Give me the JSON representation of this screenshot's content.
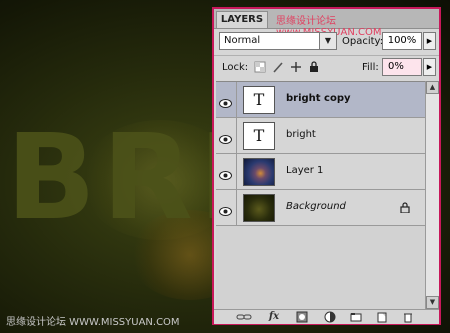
{
  "background": {
    "text": "BRI",
    "watermark_bottom": "思缘设计论坛 WWW.MISSYUAN.COM"
  },
  "panel": {
    "tab_label": "LAYERS",
    "watermark_top": "思缘设计论坛 www.MISSYUAN.COM",
    "blend_mode": "Normal",
    "opacity_label": "Opacity:",
    "opacity_value": "100%",
    "lock_label": "Lock:",
    "fill_label": "Fill:",
    "fill_value": "0%",
    "layers": [
      {
        "name": "bright copy",
        "thumb": "T",
        "selected": true
      },
      {
        "name": "bright",
        "thumb": "T",
        "selected": false
      },
      {
        "name": "Layer 1",
        "thumb": "",
        "selected": false
      },
      {
        "name": "Background",
        "thumb": "",
        "selected": false
      }
    ],
    "bottom_icons": [
      "link-layers-icon",
      "fx-icon",
      "add-mask-icon",
      "adjustment-layer-icon",
      "new-group-icon",
      "new-layer-icon",
      "trash-icon"
    ],
    "bottom_labels": {
      "fx": "fx"
    }
  },
  "colors": {
    "accent_border": "#c8185a",
    "selected_row": "#b2b7c8"
  }
}
